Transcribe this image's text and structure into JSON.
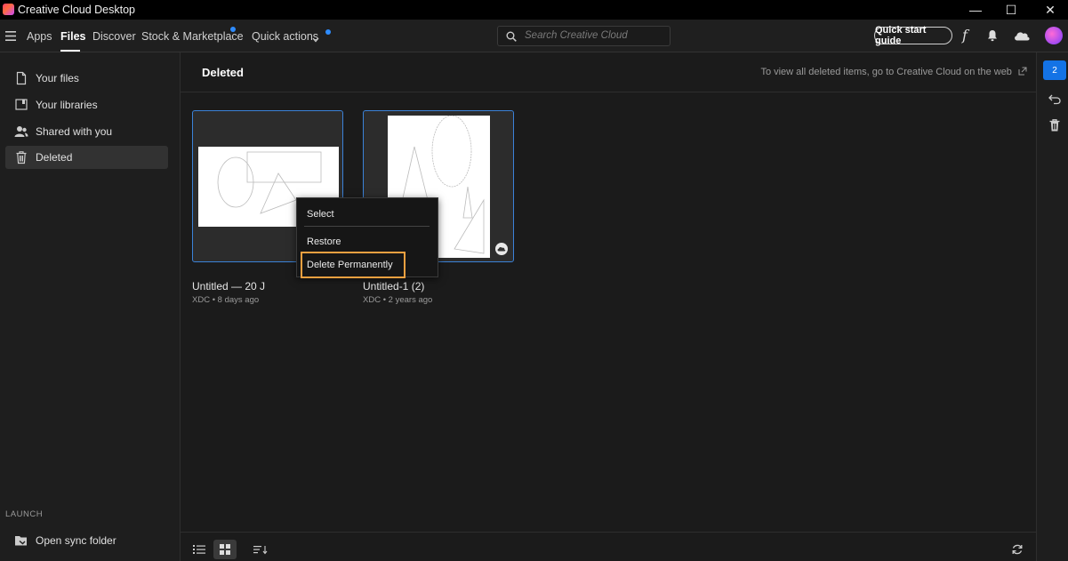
{
  "window": {
    "title": "Creative Cloud Desktop",
    "minimize_glyph": "—",
    "maximize_glyph": "☐",
    "close_glyph": "✕"
  },
  "nav": {
    "items": [
      {
        "label": "Apps"
      },
      {
        "label": "Files"
      },
      {
        "label": "Discover"
      },
      {
        "label": "Stock & Marketplace"
      },
      {
        "label": "Quick actions"
      }
    ],
    "active": "Files",
    "search_placeholder": "Search Creative Cloud",
    "quick_start_label": "Quick start guide",
    "fonts_glyph": "f"
  },
  "sidebar": {
    "items": [
      {
        "label": "Your files",
        "icon": "file-icon"
      },
      {
        "label": "Your libraries",
        "icon": "libraries-icon"
      },
      {
        "label": "Shared with you",
        "icon": "shared-users-icon"
      },
      {
        "label": "Deleted",
        "icon": "trash-icon"
      }
    ],
    "active": "Deleted",
    "launch_label": "LAUNCH",
    "open_sync_label": "Open sync folder"
  },
  "main": {
    "title": "Deleted",
    "web_hint": "To view all deleted items, go to Creative Cloud on the web",
    "files": [
      {
        "name": "Untitled — 20 J",
        "meta": "XDC • 8 days ago"
      },
      {
        "name": "Untitled-1 (2)",
        "meta": "XDC • 2 years ago"
      }
    ]
  },
  "context_menu": {
    "items": [
      {
        "label": "Select"
      },
      {
        "label": "Restore"
      },
      {
        "label": "Delete Permanently"
      }
    ],
    "highlighted": "Delete Permanently"
  },
  "rail": {
    "badge_count": "2"
  },
  "colors": {
    "accent": "#1473e6",
    "highlight_border": "#f0a040",
    "card_border": "#3b82d8"
  }
}
